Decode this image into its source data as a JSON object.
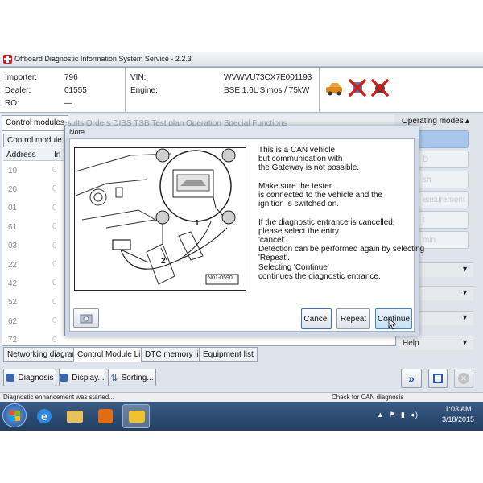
{
  "window": {
    "title": "Offboard Diagnostic Information System Service - 2.2.3"
  },
  "info": {
    "importer_label": "Importer:",
    "importer_value": "796",
    "dealer_label": "Dealer:",
    "dealer_value": "01555",
    "ro_label": "RO:",
    "ro_value": "—",
    "vin_label": "VIN:",
    "vin_value": "WVWVU73CX7E001193",
    "engine_label": "Engine:",
    "engine_value": "BSE 1.6L Simos / 75kW"
  },
  "tabs_top": {
    "control_modules": "Control modules",
    "obscured": "esults  Orders  DISS  TSB  Test plan  Operation  Special Functions"
  },
  "left_pane": {
    "sub_tab": "Control module lis",
    "col_address": "Address",
    "col_in": "In",
    "rows": [
      "10",
      "20",
      "01",
      "61",
      "03",
      "22",
      "42",
      "52",
      "62",
      "72"
    ]
  },
  "bottom_tabs": [
    "Networking diagram",
    "Control Module List",
    "DTC memory list",
    "Equipment list"
  ],
  "bottom_buttons": {
    "diagnosis": "Diagnosis",
    "display": "Display...",
    "sorting": "Sorting..."
  },
  "right_panel": {
    "header": "Operating modes",
    "faded_buttons": [
      "",
      "D",
      "sh",
      "easurement",
      "t",
      "min"
    ],
    "sections": [
      "",
      "",
      "",
      "",
      "Help"
    ]
  },
  "dialog": {
    "title": "Note",
    "lines": [
      "This is a CAN vehicle",
      "but communication with",
      "the Gateway is not possible.",
      "",
      "Make sure the tester",
      "is connected to the vehicle and the",
      "ignition is switched on.",
      "",
      "If the diagnostic entrance is cancelled,",
      "please select the entry",
      "'cancel'.",
      "Detection can be performed again by selecting",
      "'Repeat'.",
      "Selecting 'Continue'",
      "continues the diagnostic entrance."
    ],
    "figure_label_1": "1",
    "figure_label_2": "2",
    "figure_code": "N01-0590",
    "btn_cancel": "Cancel",
    "btn_repeat": "Repeat",
    "btn_continue": "Continue"
  },
  "status": {
    "left": "Diagnostic enhancement was started...",
    "right": "Check for CAN diagnosis"
  },
  "taskbar": {
    "time": "1:03 AM",
    "date": "3/18/2015"
  },
  "colors": {
    "accent_red": "#cc1f1f",
    "taskbar": "#2a4a72",
    "dialog_bg": "#cfd8e4"
  }
}
